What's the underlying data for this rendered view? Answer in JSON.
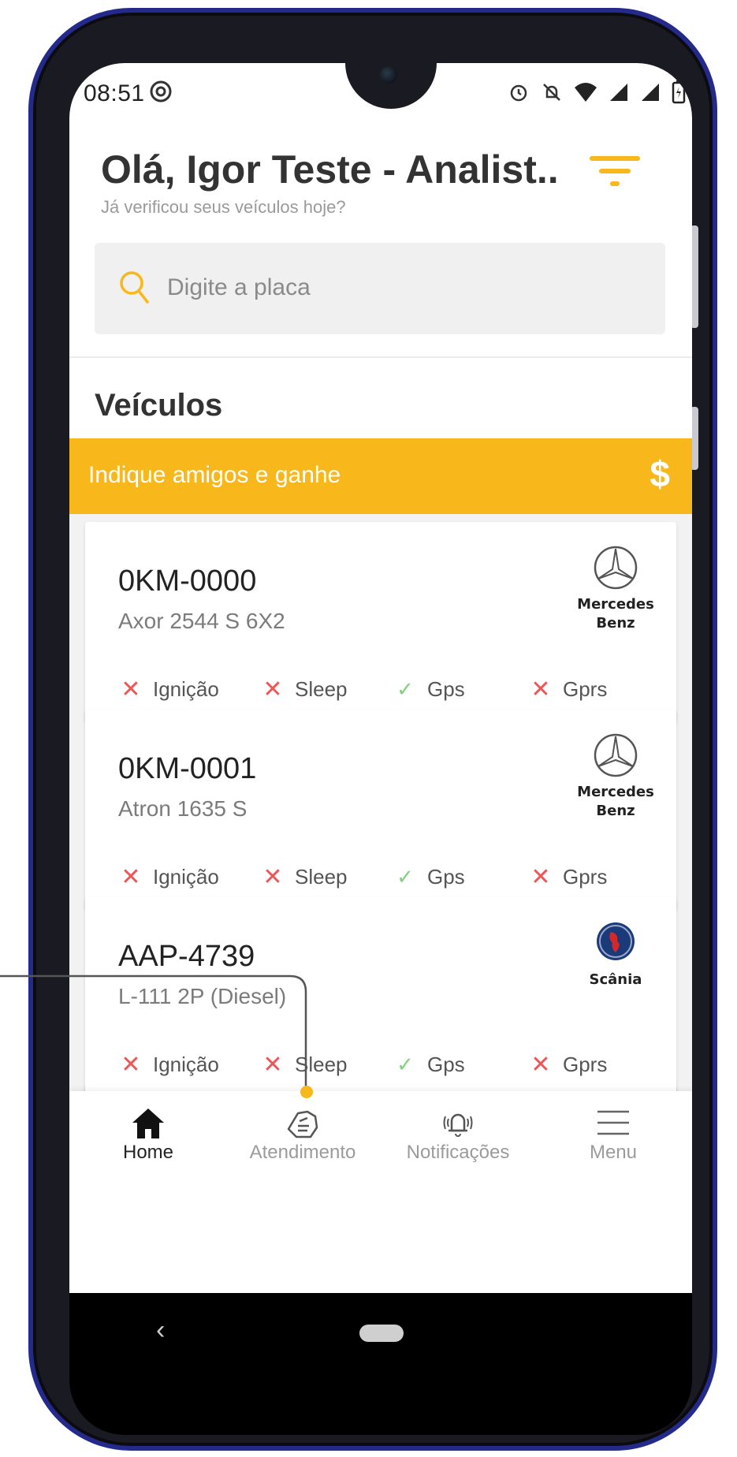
{
  "status_bar": {
    "time": "08:51",
    "icons": [
      "at-sign-icon",
      "alarm-icon",
      "mute-icon",
      "wifi-icon",
      "signal-icon",
      "signal-icon",
      "battery-icon"
    ]
  },
  "header": {
    "greeting": "Olá, Igor Teste - Analist..",
    "subtitle": "Já verificou seus veículos hoje?"
  },
  "search": {
    "placeholder": "Digite a placa"
  },
  "section": {
    "title": "Veículos"
  },
  "promo": {
    "text": "Indique amigos e ganhe",
    "icon_text": "$"
  },
  "vehicles": [
    {
      "plate": "0KM-0000",
      "model": "Axor 2544 S 6X2",
      "brand_line1": "Mercedes",
      "brand_line2": "Benz",
      "brand_icon": "mercedes-star-icon",
      "statuses": [
        {
          "label": "Ignição",
          "ok": false
        },
        {
          "label": "Sleep",
          "ok": false
        },
        {
          "label": "Gps",
          "ok": true
        },
        {
          "label": "Gprs",
          "ok": false
        }
      ]
    },
    {
      "plate": "0KM-0001",
      "model": "Atron 1635 S",
      "brand_line1": "Mercedes",
      "brand_line2": "Benz",
      "brand_icon": "mercedes-star-icon",
      "statuses": [
        {
          "label": "Ignição",
          "ok": false
        },
        {
          "label": "Sleep",
          "ok": false
        },
        {
          "label": "Gps",
          "ok": true
        },
        {
          "label": "Gprs",
          "ok": false
        }
      ]
    },
    {
      "plate": "AAP-4739",
      "model": "L-111 2P (Diesel)",
      "brand_line1": "Scânia",
      "brand_line2": "",
      "brand_icon": "scania-griffin-icon",
      "statuses": [
        {
          "label": "Ignição",
          "ok": false
        },
        {
          "label": "Sleep",
          "ok": false
        },
        {
          "label": "Gps",
          "ok": true
        },
        {
          "label": "Gprs",
          "ok": false
        }
      ]
    }
  ],
  "status_glyphs": {
    "ok": "✓",
    "fail": "✕"
  },
  "tabs": [
    {
      "label": "Home",
      "icon": "home-icon",
      "active": true
    },
    {
      "label": "Atendimento",
      "icon": "handshake-icon",
      "active": false
    },
    {
      "label": "Notificações",
      "icon": "bell-ringing-icon",
      "active": false
    },
    {
      "label": "Menu",
      "icon": "hamburger-menu-icon",
      "active": false
    }
  ],
  "system_nav": {
    "back_glyph": "‹"
  },
  "colors": {
    "accent": "#f8b71a",
    "error": "#ec5656",
    "success": "#7ed37a",
    "frame": "#232a8c"
  }
}
